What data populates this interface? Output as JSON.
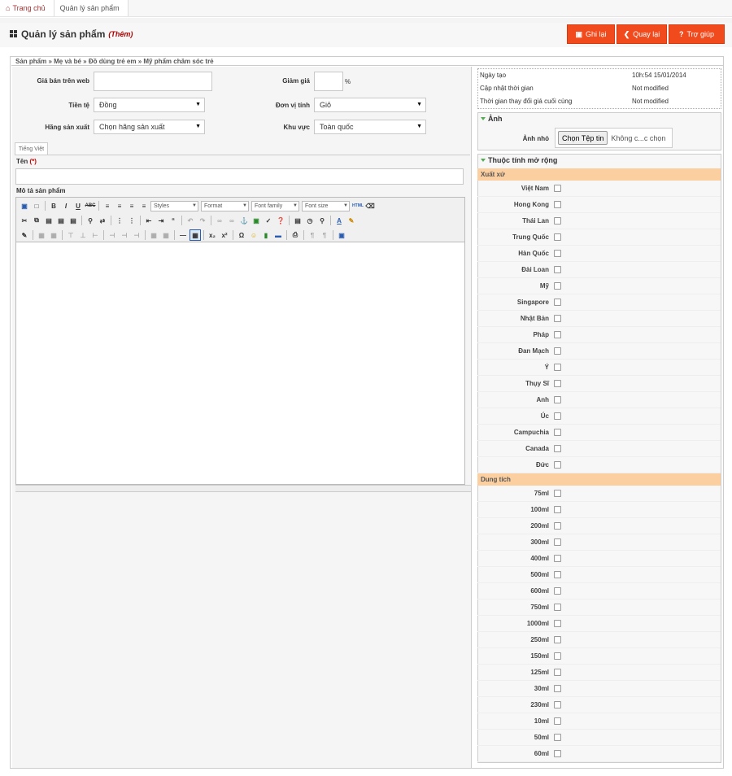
{
  "breadcrumb": {
    "home": "Trang chủ",
    "current": "Quản lý sản phẩm"
  },
  "page": {
    "title": "Quản lý sản phẩm",
    "mode": "(Thêm)"
  },
  "toolbar": {
    "save": "Ghi lại",
    "back": "Quay lại",
    "help": "Trợ giúp"
  },
  "category_path": "Sản phẩm » Mẹ và bé » Đồ dùng trẻ em » Mỹ phẩm chăm sóc trẻ",
  "form": {
    "web_price_label": "Giá bán trên web",
    "discount_label": "Giảm giá",
    "percent": "%",
    "currency_label": "Tiền tệ",
    "currency_value": "Đồng",
    "unit_label": "Đơn vị tính",
    "unit_value": "Giỏ",
    "manufacturer_label": "Hãng sản xuất",
    "manufacturer_value": "Chọn hãng sản xuất",
    "region_label": "Khu vực",
    "region_value": "Toàn quốc",
    "lang_tab": "Tiếng Việt",
    "name_label": "Tên",
    "required_mark": "(*)",
    "desc_label": "Mô tả sản phẩm"
  },
  "editor": {
    "styles": "Styles",
    "format": "Format",
    "font_family": "Font family",
    "font_size": "Font size"
  },
  "meta": {
    "created_label": "Ngày tạo",
    "created_value": "10h:54 15/01/2014",
    "updated_label": "Cập nhật thời gian",
    "updated_value": "Not modified",
    "price_changed_label": "Thời gian thay đổi giá cuối cùng",
    "price_changed_value": "Not modified"
  },
  "image_section": {
    "title": "Ảnh",
    "thumb_label": "Ảnh nhỏ",
    "choose_button": "Chọn Tệp tin",
    "no_file": "Không c...c chọn"
  },
  "ext_section": {
    "title": "Thuộc tính mở rộng",
    "origin": {
      "label": "Xuất xứ",
      "options": [
        "Việt Nam",
        "Hong Kong",
        "Thái Lan",
        "Trung Quốc",
        "Hàn Quốc",
        "Đài Loan",
        "Mỹ",
        "Singapore",
        "Nhật Bản",
        "Pháp",
        "Đan Mạch",
        "Ý",
        "Thụy Sĩ",
        "Anh",
        "Úc",
        "Campuchia",
        "Canada",
        "Đức"
      ]
    },
    "volume": {
      "label": "Dung tích",
      "options": [
        "75ml",
        "100ml",
        "200ml",
        "300ml",
        "400ml",
        "500ml",
        "600ml",
        "750ml",
        "1000ml",
        "250ml",
        "150ml",
        "125ml",
        "30ml",
        "230ml",
        "10ml",
        "50ml",
        "60ml"
      ]
    }
  },
  "colors": {
    "accent": "#f04a1d",
    "group_header": "#fbcf9f"
  }
}
